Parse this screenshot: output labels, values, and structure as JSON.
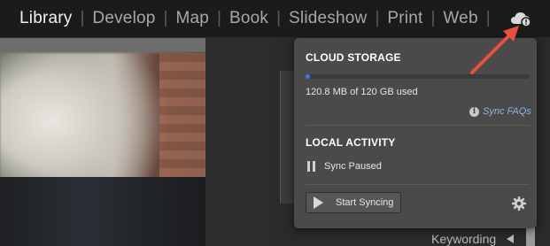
{
  "modules": [
    {
      "label": "Library",
      "active": true
    },
    {
      "label": "Develop",
      "active": false
    },
    {
      "label": "Map",
      "active": false
    },
    {
      "label": "Book",
      "active": false
    },
    {
      "label": "Slideshow",
      "active": false
    },
    {
      "label": "Print",
      "active": false
    },
    {
      "label": "Web",
      "active": false
    }
  ],
  "cloud_icon": "cloud-status-icon",
  "popover": {
    "cloud_storage_title": "CLOUD STORAGE",
    "storage_used_fraction": 0.001,
    "storage_usage_text": "120.8 MB of 120 GB used",
    "sync_faqs_label": "Sync FAQs",
    "local_activity_title": "LOCAL ACTIVITY",
    "sync_status_text": "Sync Paused",
    "start_syncing_label": "Start Syncing"
  },
  "right_panel": {
    "keywording_label": "Keywording"
  },
  "colors": {
    "accent_blue": "#2f7ff0",
    "popover_bg": "#4a4a4a",
    "arrow_red": "#e8503f",
    "link_blue": "#8fb4e6"
  }
}
